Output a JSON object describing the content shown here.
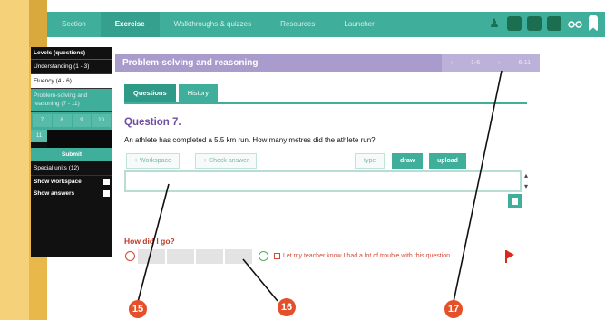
{
  "nav": {
    "tabs": [
      "Section",
      "Exercise",
      "Walkthroughs & quizzes",
      "Resources",
      "Launcher"
    ],
    "active_tab": "Exercise"
  },
  "left_panel": {
    "heading": "Levels (questions)",
    "items": [
      {
        "label": "Understanding (1 - 3)"
      },
      {
        "label": "Fluency (4 - 6)"
      },
      {
        "label": "Problem-solving and reasoning (7 - 11)"
      }
    ],
    "grid": [
      "7",
      "8",
      "9",
      "10",
      "11"
    ],
    "submit": "Submit",
    "special": "Special units (12)",
    "show_workspace": "Show workspace",
    "show_answers": "Show answers"
  },
  "title_bar": {
    "title": "Problem-solving and reasoning",
    "nav": [
      "‹",
      "1-6",
      "›",
      "6-11"
    ]
  },
  "tabs": [
    "Questions",
    "History"
  ],
  "question": {
    "title": "Question 7.",
    "text": "An athlete has completed a 5.5 km run. How many metres did the athlete run?"
  },
  "toolbar": {
    "workspace": "+ Workspace",
    "check": "+ Check answer",
    "type": "type",
    "draw": "draw",
    "upload": "upload"
  },
  "answer": {
    "value": ""
  },
  "feedback": {
    "heading": "How did I go?",
    "trouble": "Let my teacher know I had a lot of trouble with this question."
  },
  "callouts": [
    "15",
    "16",
    "17"
  ],
  "colors": {
    "teal": "#3fae9b",
    "purple": "#a99ccd",
    "callout": "#e5502a"
  }
}
